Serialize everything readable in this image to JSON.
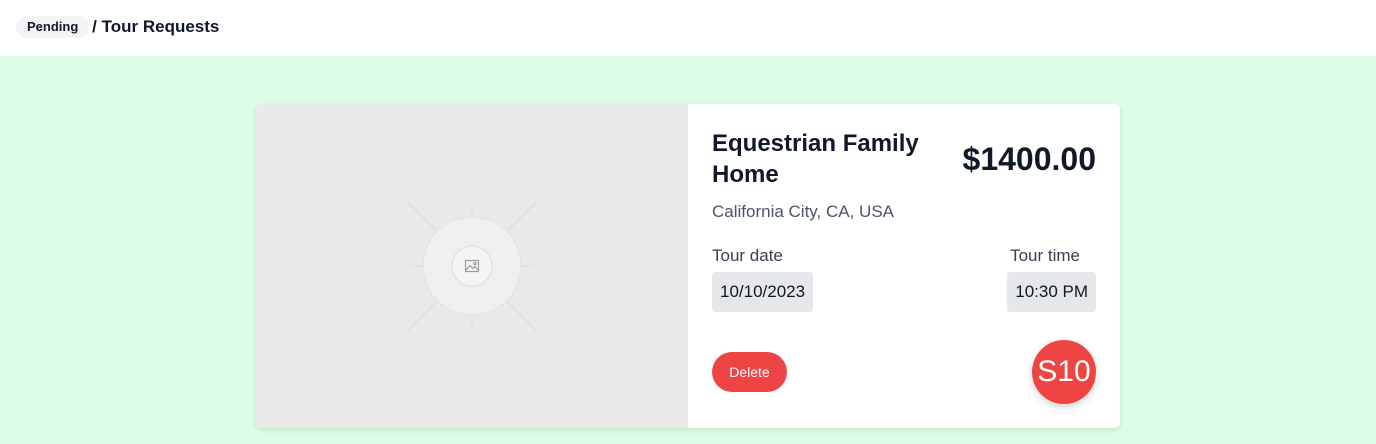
{
  "header": {
    "breadcrumb": "e / Tour Requests",
    "status_badge": "Pending"
  },
  "card": {
    "image_icon": "image-placeholder-icon",
    "title": "Equestrian Family Home",
    "price": "$1400.00",
    "location": "California City, CA, USA",
    "tour_date_label": "Tour date",
    "tour_date_value": "10/10/2023",
    "tour_time_label": "Tour time",
    "tour_time_value": "10:30 PM",
    "delete_label": "Delete",
    "avatar_initials": "S10"
  },
  "colors": {
    "page_background": "#dcfce7",
    "accent_red": "#ef4444",
    "value_chip": "#e5e7eb"
  }
}
